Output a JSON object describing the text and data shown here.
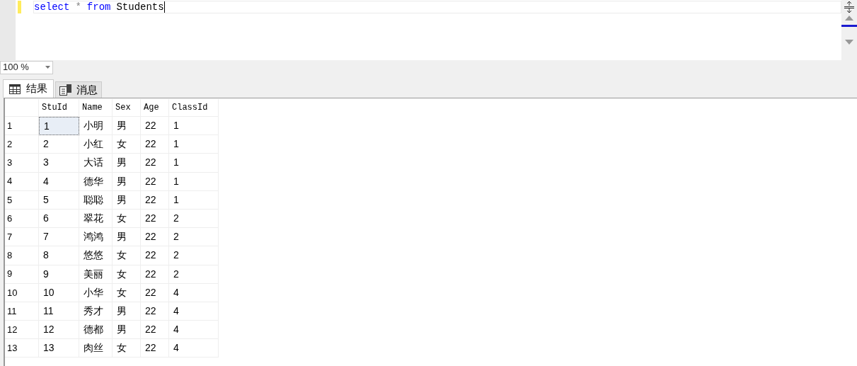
{
  "editor": {
    "code": [
      {
        "text": "select",
        "kind": "keyword"
      },
      {
        "text": "*",
        "kind": "operator"
      },
      {
        "text": "from",
        "kind": "keyword"
      },
      {
        "text": "Students",
        "kind": "identifier"
      }
    ]
  },
  "zoom": {
    "value": "100 %"
  },
  "tabs": [
    {
      "label": "结果",
      "selected": true,
      "kind": "grid"
    },
    {
      "label": "消息",
      "selected": false,
      "kind": "messages"
    }
  ],
  "table": {
    "columns": [
      "StuId",
      "Name",
      "Sex",
      "Age",
      "ClassId"
    ],
    "rows": [
      {
        "number": "1",
        "selected": true,
        "cells": [
          "1",
          "小明",
          "男",
          "22",
          "1"
        ]
      },
      {
        "number": "2",
        "selected": false,
        "cells": [
          "2",
          "小红",
          "女",
          "22",
          "1"
        ]
      },
      {
        "number": "3",
        "selected": false,
        "cells": [
          "3",
          "大话",
          "男",
          "22",
          "1"
        ]
      },
      {
        "number": "4",
        "selected": false,
        "cells": [
          "4",
          "德华",
          "男",
          "22",
          "1"
        ]
      },
      {
        "number": "5",
        "selected": false,
        "cells": [
          "5",
          "聪聪",
          "男",
          "22",
          "1"
        ]
      },
      {
        "number": "6",
        "selected": false,
        "cells": [
          "6",
          "翠花",
          "女",
          "22",
          "2"
        ]
      },
      {
        "number": "7",
        "selected": false,
        "cells": [
          "7",
          "鸿鸿",
          "男",
          "22",
          "2"
        ]
      },
      {
        "number": "8",
        "selected": false,
        "cells": [
          "8",
          "悠悠",
          "女",
          "22",
          "2"
        ]
      },
      {
        "number": "9",
        "selected": false,
        "cells": [
          "9",
          "美丽",
          "女",
          "22",
          "2"
        ]
      },
      {
        "number": "10",
        "selected": false,
        "cells": [
          "10",
          "小华",
          "女",
          "22",
          "4"
        ]
      },
      {
        "number": "11",
        "selected": false,
        "cells": [
          "11",
          "秀才",
          "男",
          "22",
          "4"
        ]
      },
      {
        "number": "12",
        "selected": false,
        "cells": [
          "12",
          "德都",
          "男",
          "22",
          "4"
        ]
      },
      {
        "number": "13",
        "selected": false,
        "cells": [
          "13",
          "肉丝",
          "女",
          "22",
          "4"
        ]
      }
    ]
  }
}
